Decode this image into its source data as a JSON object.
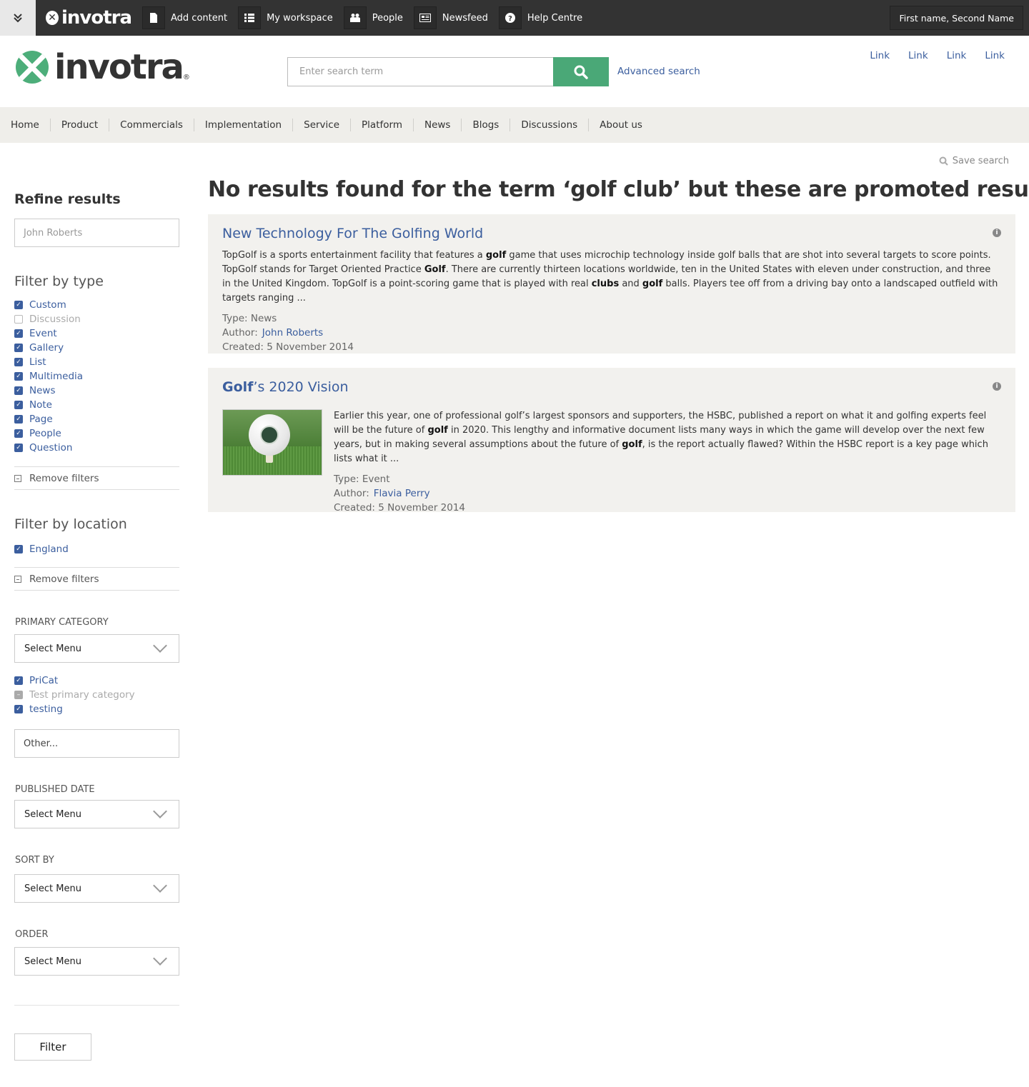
{
  "topbar": {
    "logo": "invotra",
    "items": [
      {
        "label": "Add content",
        "icon": "document-icon"
      },
      {
        "label": "My workspace",
        "icon": "list-icon"
      },
      {
        "label": "People",
        "icon": "people-icon"
      },
      {
        "label": "Newsfeed",
        "icon": "newspaper-icon"
      },
      {
        "label": "Help Centre",
        "icon": "help-icon"
      }
    ],
    "user": "First name, Second Name"
  },
  "header": {
    "logo": "invotra",
    "search_placeholder": "Enter search term",
    "advanced_search": "Advanced search",
    "links": [
      "Link",
      "Link",
      "Link",
      "Link"
    ]
  },
  "nav": [
    "Home",
    "Product",
    "Commercials",
    "Implementation",
    "Service",
    "Platform",
    "News",
    "Blogs",
    "Discussions",
    "About us"
  ],
  "save_search": "Save search",
  "sidebar": {
    "refine_title": "Refine results",
    "refine_value": "John Roberts",
    "filter_type_title": "Filter by type",
    "types": [
      {
        "label": "Custom",
        "checked": true
      },
      {
        "label": "Discussion",
        "checked": false
      },
      {
        "label": "Event",
        "checked": true
      },
      {
        "label": "Gallery",
        "checked": true
      },
      {
        "label": "List",
        "checked": true
      },
      {
        "label": "Multimedia",
        "checked": true
      },
      {
        "label": "News",
        "checked": true
      },
      {
        "label": "Note",
        "checked": true
      },
      {
        "label": "Page",
        "checked": true
      },
      {
        "label": "People",
        "checked": true
      },
      {
        "label": "Question",
        "checked": true
      }
    ],
    "remove_filters": "Remove filters",
    "filter_location_title": "Filter by location",
    "locations": [
      {
        "label": "England",
        "checked": true
      }
    ],
    "primary_category_label": "PRIMARY CATEGORY",
    "select_menu": "Select Menu",
    "categories": [
      {
        "label": "PriCat",
        "state": "checked"
      },
      {
        "label": "Test primary category",
        "state": "indeterminate"
      },
      {
        "label": "testing",
        "state": "checked"
      }
    ],
    "other_placeholder": "Other...",
    "published_date_label": "PUBLISHED DATE",
    "sort_by_label": "SORT BY",
    "order_label": "ORDER",
    "filter_button": "Filter"
  },
  "main": {
    "title": "No results found for the term ‘golf club’ but these are promoted results",
    "results": [
      {
        "title": "New Technology For The Golfing World",
        "snippet_parts": [
          {
            "t": "TopGolf is a sports entertainment facility that features a "
          },
          {
            "t": "golf",
            "b": true
          },
          {
            "t": " game that uses microchip technology inside golf balls that are shot into several targets to score points. TopGolf stands for Target Oriented Practice "
          },
          {
            "t": "Golf",
            "b": true
          },
          {
            "t": ". There are currently thirteen locations worldwide, ten in the United States with eleven under construction, and three in the United Kingdom. TopGolf is a point-scoring game that is played with real "
          },
          {
            "t": "clubs",
            "b": true
          },
          {
            "t": " and "
          },
          {
            "t": "golf",
            "b": true
          },
          {
            "t": " balls. Players tee off from a driving bay onto a landscaped outfield with targets ranging ..."
          }
        ],
        "type": "Type: News",
        "author_label": "Author:",
        "author": "John Roberts",
        "created": "Created: 5 November 2014"
      },
      {
        "title_bold": "Golf",
        "title_rest": "’s 2020 Vision",
        "snippet_parts": [
          {
            "t": "Earlier this year, one of professional golf’s largest sponsors and supporters, the HSBC, published a report on what it and golfing experts feel will be the future of "
          },
          {
            "t": "golf",
            "b": true
          },
          {
            "t": " in 2020. This lengthy and informative document lists many ways in which the game will develop over the next few years, but in making several assumptions about the future of "
          },
          {
            "t": "golf",
            "b": true
          },
          {
            "t": ", is the report actually flawed? Within the HSBC report is a key page which lists what it ..."
          }
        ],
        "type": "Type: Event",
        "author_label": "Author:",
        "author": "Flavia Perry",
        "created": "Created: 5 November 2014"
      }
    ]
  }
}
